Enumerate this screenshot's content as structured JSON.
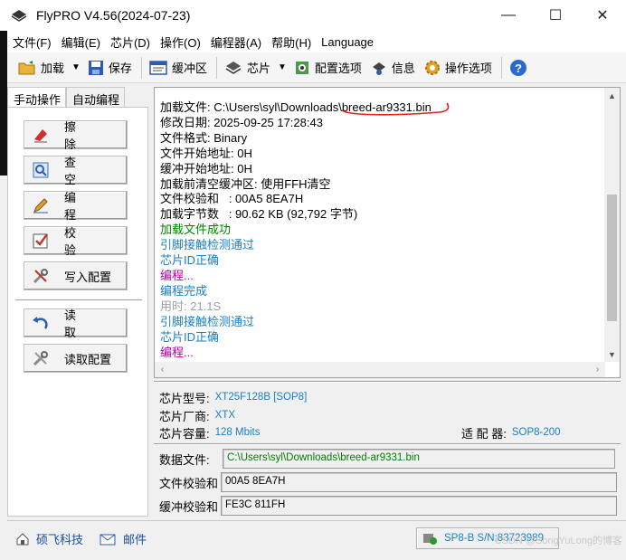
{
  "window": {
    "title": "FlyPRO V4.56(2024-07-23)",
    "minimize": "—",
    "maximize": "☐",
    "close": "✕"
  },
  "menu": [
    "文件(F)",
    "编辑(E)",
    "芯片(D)",
    "操作(O)",
    "编程器(A)",
    "帮助(H)",
    "Language"
  ],
  "toolbar": {
    "load": "加载",
    "save": "保存",
    "buffer": "缓冲区",
    "chip": "芯片",
    "config": "配置选项",
    "info": "信息",
    "options": "操作选项"
  },
  "tabs": {
    "manual": "手动操作",
    "auto": "自动编程"
  },
  "ops": {
    "erase": "擦除",
    "blank": "查空",
    "program": "编程",
    "verify": "校验",
    "write_config": "写入配置",
    "read": "读取",
    "read_config": "读取配置"
  },
  "log": [
    {
      "text": "加载文件: C:\\Users\\syl\\Downloads\\breed-ar9331.bin",
      "color": "black"
    },
    {
      "text": "修改日期: 2025-09-25 17:28:43",
      "color": "black"
    },
    {
      "text": "文件格式: Binary",
      "color": "black"
    },
    {
      "text": "文件开始地址: 0H",
      "color": "black"
    },
    {
      "text": "缓冲开始地址: 0H",
      "color": "black"
    },
    {
      "text": "加载前清空缓冲区: 使用FFH清空",
      "color": "black"
    },
    {
      "text": "文件校验和   : 00A5 8EA7H",
      "color": "black"
    },
    {
      "text": "加载字节数   : 90.62 KB (92,792 字节)",
      "color": "black"
    },
    {
      "text": "加载文件成功",
      "color": "green"
    },
    {
      "text": "引脚接触检测通过",
      "color": "blue"
    },
    {
      "text": "芯片ID正确",
      "color": "blue"
    },
    {
      "text": "编程...",
      "color": "purple"
    },
    {
      "text": "编程完成",
      "color": "blue"
    },
    {
      "text": "用时: 21.1S",
      "color": "gray"
    },
    {
      "text": "引脚接触检测通过",
      "color": "blue"
    },
    {
      "text": "芯片ID正确",
      "color": "blue"
    },
    {
      "text": "编程...",
      "color": "purple"
    }
  ],
  "chip": {
    "model_label": "芯片型号:",
    "model": "XT25F128B [SOP8]",
    "vendor_label": "芯片厂商:",
    "vendor": "XTX",
    "capacity_label": "芯片容量:",
    "capacity": "128 Mbits",
    "adapter_label": "适 配 器:",
    "adapter": "SOP8-200"
  },
  "fields": {
    "data_file_label": "数据文件:",
    "data_file": "C:\\Users\\syl\\Downloads\\breed-ar9331.bin",
    "file_checksum_label": "文件校验和",
    "file_checksum": "00A5 8EA7H",
    "buffer_checksum_label": "缓冲校验和",
    "buffer_checksum": "FE3C 811FH"
  },
  "status": {
    "company": "硕飞科技",
    "mail": "邮件",
    "device": "SP8-B  S/N:83723989",
    "watermark": "CSDN @SongYuLong的博客"
  }
}
